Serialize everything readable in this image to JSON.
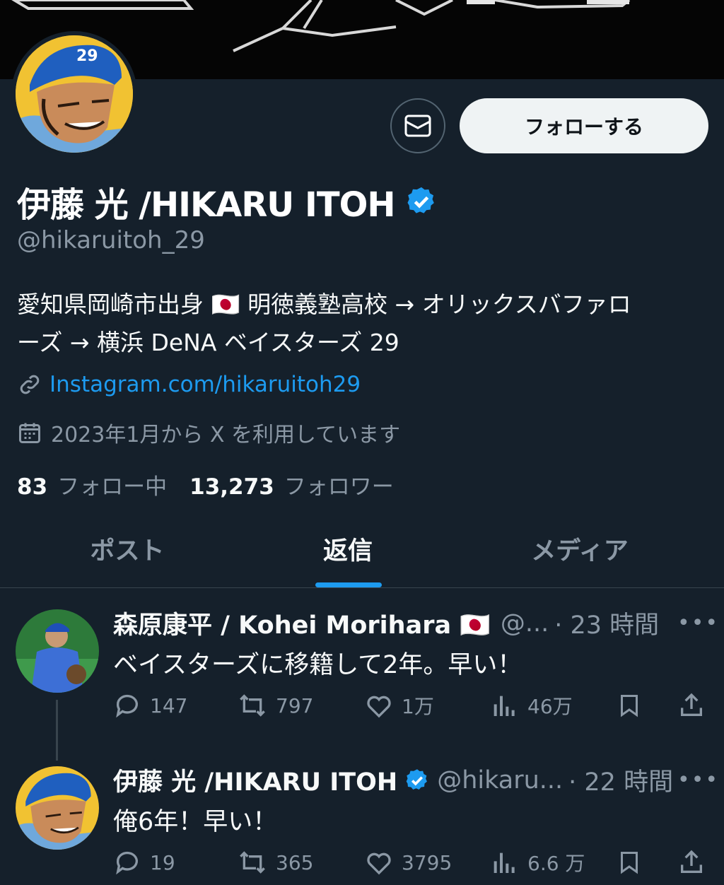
{
  "profile": {
    "name": "伊藤 光 /HIKARU ITOH",
    "handle": "@hikaruitoh_29",
    "bio_line1": "愛知県岡崎市出身 🇯🇵 明徳義塾高校 → オリックスバファロ",
    "bio_line2": "ーズ → 横浜 DeNA ベイスターズ 29",
    "link": "Instagram.com/hikaruitoh29",
    "joined": "2023年1月から X を利用しています",
    "following_count": "83",
    "following_label": "フォロー中",
    "followers_count": "13,273",
    "followers_label": "フォロワー",
    "follow_button": "フォローする",
    "avatar_cap_number": "29"
  },
  "tabs": [
    {
      "label": "ポスト"
    },
    {
      "label": "返信"
    },
    {
      "label": "メディア"
    }
  ],
  "posts": [
    {
      "author": "森原康平 / Kohei Morihara 🇯🇵",
      "handle": "@...",
      "time": "· 23 時間",
      "text": "ベイスターズに移籍して2年。早い！",
      "replies": "147",
      "reposts": "797",
      "likes": "1万",
      "views": "46万"
    },
    {
      "author": "伊藤 光 /HIKARU ITOH",
      "handle": "@hikaru...",
      "time": "· 22 時間",
      "text": "俺6年！早い！",
      "replies": "19",
      "reposts": "365",
      "likes": "3795",
      "views": "6.6 万"
    }
  ],
  "colors": {
    "background": "#15202b",
    "accent": "#1d9bf0",
    "secondary_text": "#8b98a5"
  },
  "icons": [
    "mail-icon",
    "verified-badge-icon",
    "link-icon",
    "calendar-icon",
    "reply-icon",
    "repost-icon",
    "like-icon",
    "views-icon",
    "bookmark-icon",
    "share-icon",
    "more-icon"
  ]
}
